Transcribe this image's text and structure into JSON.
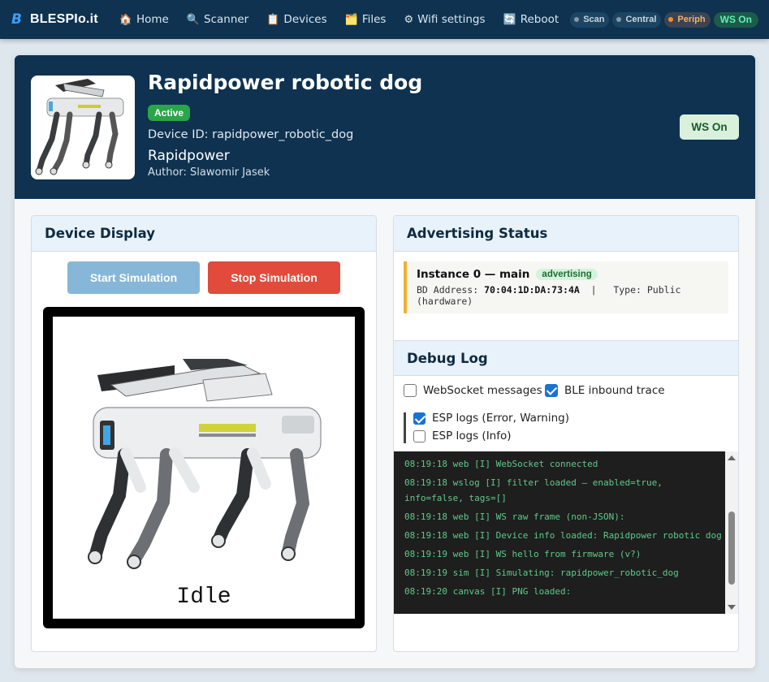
{
  "nav": {
    "logo_mark": "B",
    "brand": "BLESPIo.it",
    "items": [
      {
        "icon": "🏠",
        "label": "Home",
        "name": "nav-home"
      },
      {
        "icon": "🔍",
        "label": "Scanner",
        "name": "nav-scanner"
      },
      {
        "icon": "📋",
        "label": "Devices",
        "name": "nav-devices"
      },
      {
        "icon": "🗂️",
        "label": "Files",
        "name": "nav-files"
      },
      {
        "icon": "⚙",
        "label": "Wifi settings",
        "name": "nav-wifi-settings"
      },
      {
        "icon": "🔄",
        "label": "Reboot",
        "name": "nav-reboot"
      }
    ],
    "status": {
      "scan": "Scan",
      "central": "Central",
      "periph": "Periph",
      "ws": "WS On"
    }
  },
  "device": {
    "title": "Rapidpower robotic dog",
    "status_badge": "Active",
    "device_id": "Device ID: rapidpower_robotic_dog",
    "vendor": "Rapidpower",
    "author": "Author: Slawomir Jasek",
    "ws_button": "WS On"
  },
  "display_panel": {
    "heading": "Device Display",
    "start_label": "Start Simulation",
    "stop_label": "Stop Simulation",
    "screen_text": "Idle"
  },
  "advertising": {
    "heading": "Advertising Status",
    "instance_title": "Instance 0 — main",
    "instance_badge": "advertising",
    "bd_label": "BD Address: ",
    "bd_value": "70:04:1D:DA:73:4A",
    "type_text": "  |   Type: Public (hardware)"
  },
  "debug": {
    "heading": "Debug Log",
    "options": {
      "websocket": {
        "label": "WebSocket messages",
        "checked": false
      },
      "ble_inbound": {
        "label": "BLE inbound trace",
        "checked": true
      },
      "esp_error": {
        "label": "ESP logs (Error, Warning)",
        "checked": true
      },
      "esp_info": {
        "label": "ESP logs (Info)",
        "checked": false
      }
    },
    "log_lines": [
      "08:19:18 web [I] WebSocket connected",
      "08:19:18 wslog [I] filter loaded — enabled=true, info=false, tags=[]",
      "08:19:18 web [I] WS raw frame (non-JSON):",
      "08:19:18 web [I] Device info loaded: Rapidpower robotic dog",
      "08:19:19 web [I] WS hello from firmware (v?)",
      "08:19:19 sim [I] Simulating: rapidpower_robotic_dog",
      "08:19:20 canvas [I] PNG loaded:"
    ]
  },
  "colors": {
    "navy": "#0e3250",
    "active_green": "#2aa54a",
    "stop_red": "#e24a3b",
    "start_blue": "#86b6d8",
    "log_green": "#5fc98a"
  }
}
